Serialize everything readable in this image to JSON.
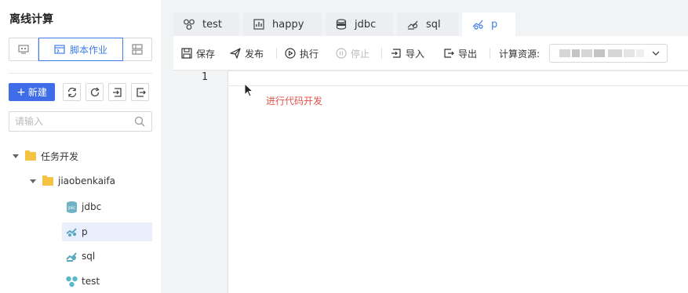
{
  "sidebar": {
    "title": "离线计算",
    "modes": {
      "script_label": "脚本作业"
    },
    "new_label": "新建",
    "search_placeholder": "请输入",
    "tree": {
      "root": "任务开发",
      "folder": "jiaobenkaifa",
      "items": [
        {
          "label": "jdbc",
          "icon": "jdbc-icon"
        },
        {
          "label": "p",
          "icon": "python-icon",
          "selected": true
        },
        {
          "label": "sql",
          "icon": "sql-icon"
        },
        {
          "label": "test",
          "icon": "flow-icon"
        }
      ]
    }
  },
  "tabs": [
    {
      "label": "test",
      "icon": "flow-icon"
    },
    {
      "label": "happy",
      "icon": "chart-icon"
    },
    {
      "label": "jdbc",
      "icon": "database-icon"
    },
    {
      "label": "sql",
      "icon": "sql-icon"
    },
    {
      "label": "p",
      "icon": "python-icon",
      "active": true
    }
  ],
  "toolbar": {
    "save": "保存",
    "publish": "发布",
    "run": "执行",
    "stop": "停止",
    "import": "导入",
    "export": "导出",
    "resource_label": "计算资源:"
  },
  "editor": {
    "line_number": "1",
    "hint": "进行代码开发"
  },
  "colors": {
    "accent": "#3f7ee8",
    "hint": "#e0524b",
    "folder": "#f5c242"
  }
}
